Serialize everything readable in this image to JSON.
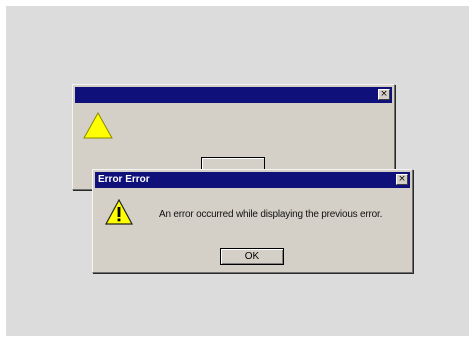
{
  "back_dialog": {
    "title": "",
    "close_glyph": "×",
    "icon": "warning-icon"
  },
  "front_dialog": {
    "title": "Error Error",
    "close_glyph": "×",
    "icon": "warning-icon",
    "message": "An error occurred while displaying the previous error.",
    "ok_label": "OK"
  },
  "colors": {
    "titlebar": "#10107a",
    "dialog_face": "#d4d0c8",
    "desktop": "#dcdcdc",
    "warning_fill": "#ffff00"
  }
}
